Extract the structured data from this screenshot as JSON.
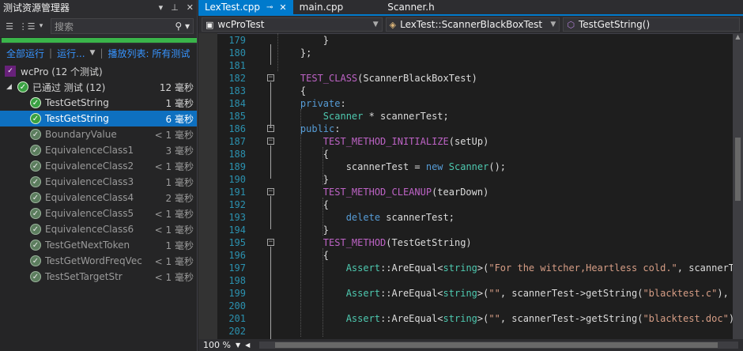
{
  "test_explorer": {
    "title": "测试资源管理器",
    "pin_label": "⊥",
    "close_label": "✕",
    "search_placeholder": "搜索",
    "progress_fraction": 1.0,
    "links": {
      "run_all": "全部运行",
      "run": "运行...",
      "playlist": "播放列表: 所有测试"
    },
    "project": "wcPro (12 个测试)",
    "group": {
      "label": "已通过 测试 (12)",
      "time": "12 毫秒"
    },
    "tests": [
      {
        "name": "TestGetString",
        "time": "1 毫秒",
        "state": "normal"
      },
      {
        "name": "TestGetString",
        "time": "6 毫秒",
        "state": "selected"
      },
      {
        "name": "BoundaryValue",
        "time": "< 1 毫秒",
        "state": "dim"
      },
      {
        "name": "EquivalenceClass1",
        "time": "3 毫秒",
        "state": "dim"
      },
      {
        "name": "EquivalenceClass2",
        "time": "< 1 毫秒",
        "state": "dim"
      },
      {
        "name": "EquivalenceClass3",
        "time": "1 毫秒",
        "state": "dim"
      },
      {
        "name": "EquivalenceClass4",
        "time": "2 毫秒",
        "state": "dim"
      },
      {
        "name": "EquivalenceClass5",
        "time": "< 1 毫秒",
        "state": "dim"
      },
      {
        "name": "EquivalenceClass6",
        "time": "< 1 毫秒",
        "state": "dim"
      },
      {
        "name": "TestGetNextToken",
        "time": "1 毫秒",
        "state": "dim"
      },
      {
        "name": "TestGetWordFreqVec",
        "time": "< 1 毫秒",
        "state": "dim"
      },
      {
        "name": "TestSetTargetStr",
        "time": "< 1 毫秒",
        "state": "dim"
      }
    ]
  },
  "editor": {
    "tabs": [
      {
        "label": "LexTest.cpp",
        "active": true,
        "pin": "⊸",
        "close": "✕"
      },
      {
        "label": "main.cpp",
        "active": false
      },
      {
        "label": "Scanner.h",
        "active": false
      }
    ],
    "nav": {
      "project": "wcProTest",
      "scope": "LexTest::ScannerBlackBoxTest",
      "member": "TestGetString()"
    },
    "zoom": "100 %",
    "lines": [
      {
        "n": "179",
        "text": "        }"
      },
      {
        "n": "180",
        "text": "    };"
      },
      {
        "n": "181",
        "text": ""
      },
      {
        "n": "182",
        "text": "    TEST_CLASS(ScannerBlackBoxTest)"
      },
      {
        "n": "183",
        "text": "    {"
      },
      {
        "n": "184",
        "text": "    private:"
      },
      {
        "n": "185",
        "text": "        Scanner * scannerTest;"
      },
      {
        "n": "186",
        "text": "    public:"
      },
      {
        "n": "187",
        "text": "        TEST_METHOD_INITIALIZE(setUp)"
      },
      {
        "n": "188",
        "text": "        {"
      },
      {
        "n": "189",
        "text": "            scannerTest = new Scanner();"
      },
      {
        "n": "190",
        "text": "        }"
      },
      {
        "n": "191",
        "text": "        TEST_METHOD_CLEANUP(tearDown)"
      },
      {
        "n": "192",
        "text": "        {"
      },
      {
        "n": "193",
        "text": "            delete scannerTest;"
      },
      {
        "n": "194",
        "text": "        }"
      },
      {
        "n": "195",
        "text": "        TEST_METHOD(TestGetString)"
      },
      {
        "n": "196",
        "text": "        {"
      },
      {
        "n": "197",
        "text": "            Assert::AreEqual<string>(\"For the witcher,Heartless cold.\", scannerTest-"
      },
      {
        "n": "198",
        "text": ""
      },
      {
        "n": "199",
        "text": "            Assert::AreEqual<string>(\"\", scannerTest->getString(\"blacktest.c\"), L\"."
      },
      {
        "n": "200",
        "text": ""
      },
      {
        "n": "201",
        "text": "            Assert::AreEqual<string>(\"\", scannerTest->getString(\"blacktest.doc\"), L"
      },
      {
        "n": "202",
        "text": ""
      }
    ]
  }
}
